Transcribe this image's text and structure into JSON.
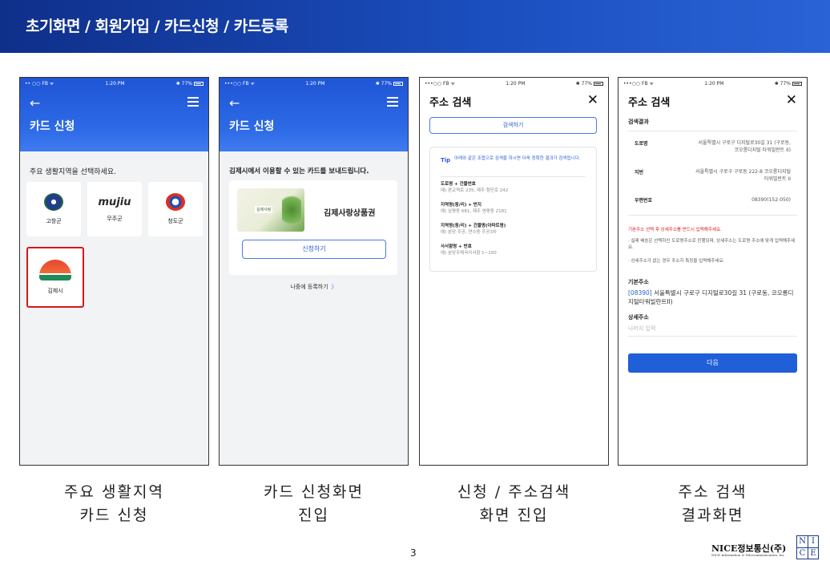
{
  "slide": {
    "title": "초기화면 / 회원가입 / 카드신청 / 카드등록",
    "page_number": "3",
    "brand": "NICE정보통신(주)",
    "brand_sub": "NICE Information & Telecommunication, Inc",
    "logo_letters": [
      "N",
      "I",
      "C",
      "E"
    ]
  },
  "status_bar": {
    "left_short": "•• ○○ FB ᯤ",
    "left_long": "•••○○ FB ᯤ",
    "time": "1:20 PM",
    "battery": "✱ 77%"
  },
  "screen1": {
    "title": "카드 신청",
    "prompt": "주요 생활지역을 선택하세요.",
    "regions": [
      {
        "label": "고창군"
      },
      {
        "label": "무주군",
        "logo_text": "mujiu"
      },
      {
        "label": "청도군"
      },
      {
        "label": "김제시"
      }
    ],
    "selected_region": "김제시",
    "caption": "주요 생활지역\n카드 신청"
  },
  "screen2": {
    "title": "카드 신청",
    "prompt": "김제시에서 이용할 수 있는 카드를 보내드립니다.",
    "card_name": "김제사랑상품권",
    "card_image_label": "김제사랑",
    "apply_button": "신청하기",
    "later_link": "나중에 등록하기",
    "later_chevron": "〉",
    "caption": "카드 신청화면\n진입"
  },
  "screen3": {
    "title": "주소 검색",
    "search_button": "검색하기",
    "tip_label": "Tip",
    "tip_text": "아래와 같은 조합으로 검색을 하시면 더욱 정확한 결과가 검색됩니다.",
    "examples": [
      {
        "label": "도로명 + 건물번호",
        "value": "예) 판교역로 235, 제주 첨단로 242"
      },
      {
        "label": "지역명(동/리) + 번지",
        "value": "예) 삼평동 681, 제주 영평동 2181"
      },
      {
        "label": "지역명(동/리) + 건물명(아파트명)",
        "value": "예) 분당 주공, 연수동 주공3차"
      },
      {
        "label": "사서함명 + 번호",
        "value": "예) 분당우체국사서함 1~100"
      }
    ],
    "caption": "신청 / 주소검색\n화면 진입"
  },
  "screen4": {
    "title": "주소 검색",
    "results_title": "검색결과",
    "results": [
      {
        "label": "도로명",
        "value": "서울특별시 구로구 디지털로30길 31 (구로동, 코오롱디지털 타워빌란트 II)"
      },
      {
        "label": "지번",
        "value": "서울특별시 구로구 구로동 222-8 코오롱디지털타워빌란트 II"
      },
      {
        "label": "우편번호",
        "value": "08390(152-050)"
      }
    ],
    "notice_red": "기본주소 선택 후 상세주소를 반드시 입력해주세요.",
    "notice_1": "· 실제 배송은 선택하신 도로명주소로 진행되며, 상세주소는 도로명 주소에 맞게 입력해주세요.",
    "notice_2": "· 상세주소가 없는 경우 주소지 특징을 입력해주세요.",
    "base_address_label": "기본주소",
    "base_address_zip": "[08390]",
    "base_address_text": " 서울특별시 구로구 디지털로30길 31 (구로동, 코오롱디지털타워빌란트II)",
    "detail_address_label": "상세주소",
    "detail_address_placeholder": "나머지 입력",
    "next_button": "다음",
    "caption": "주소 검색\n결과화면"
  },
  "colors": {
    "header_blue": "#1b4fc0",
    "app_blue": "#2d6ae6",
    "accent_blue": "#2c5fd2",
    "selection_red": "#d9151e"
  }
}
